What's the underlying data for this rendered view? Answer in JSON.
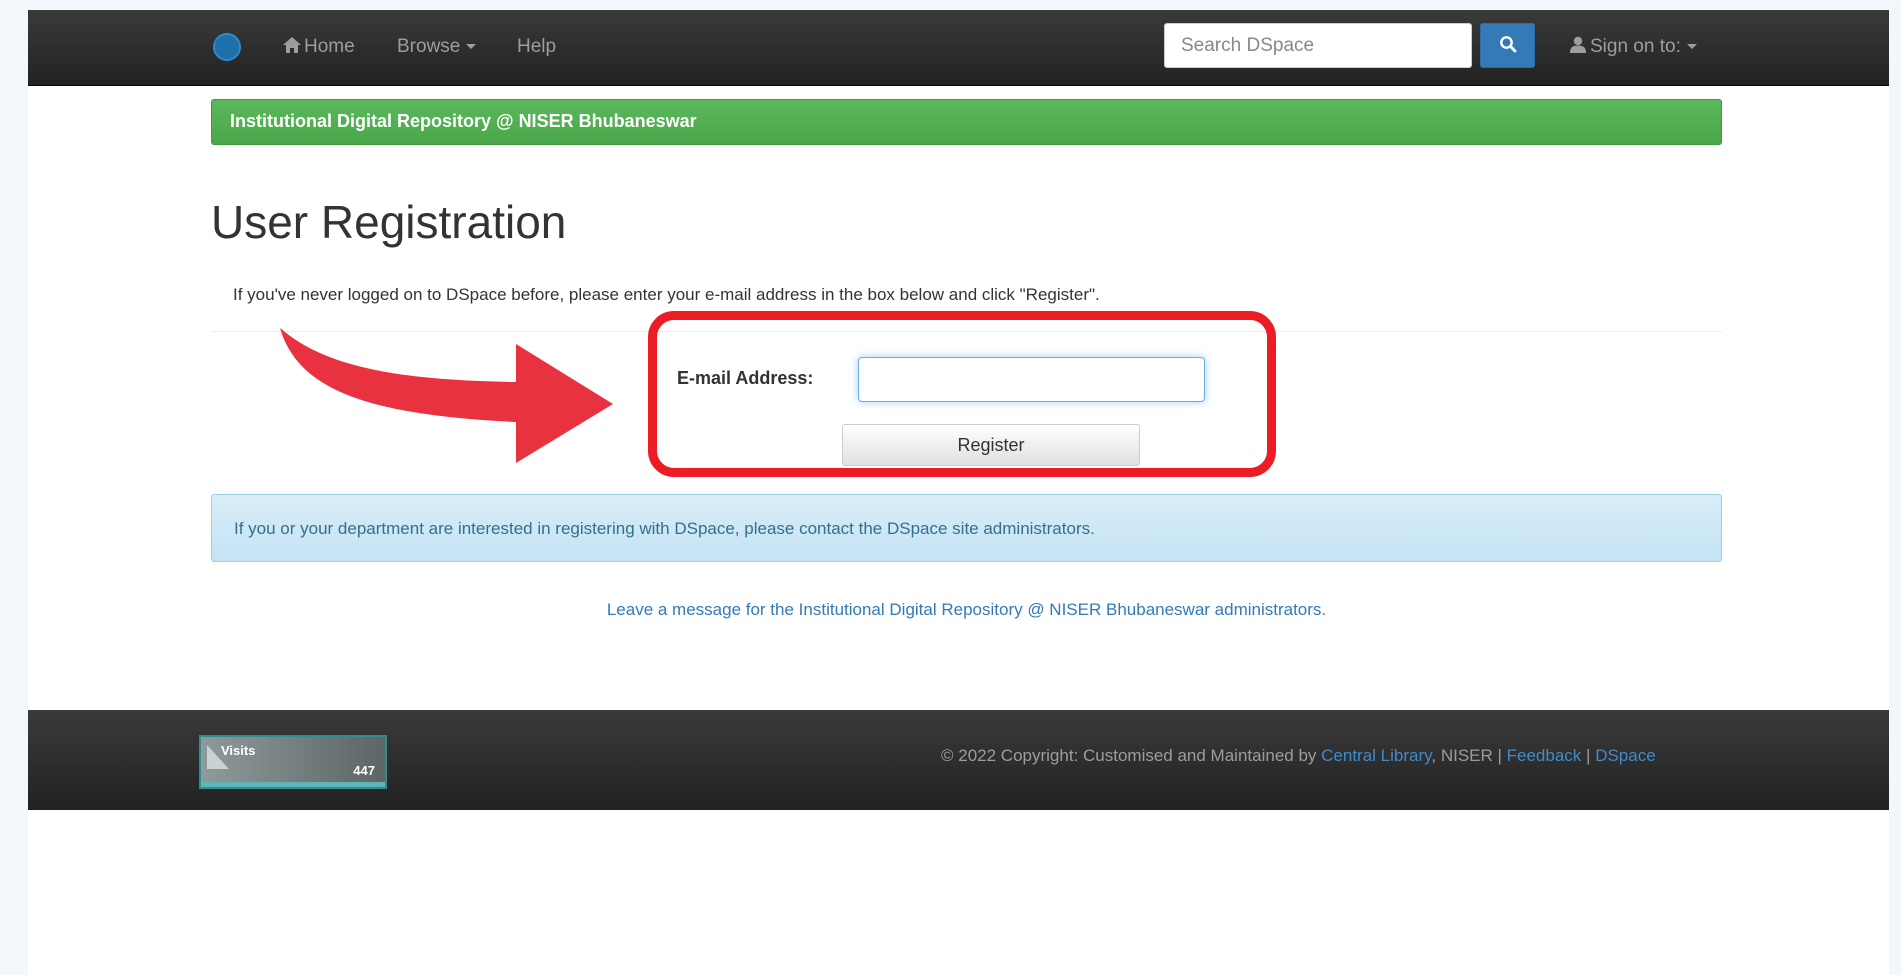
{
  "navbar": {
    "home_label": "Home",
    "browse_label": "Browse",
    "help_label": "Help",
    "search_placeholder": "Search DSpace",
    "sign_on_label": "Sign on to:"
  },
  "banner": {
    "text": "Institutional Digital Repository @ NISER Bhubaneswar"
  },
  "main": {
    "title": "User Registration",
    "intro": "If you've never logged on to DSpace before, please enter your e-mail address in the box below and click \"Register\".",
    "email_label": "E-mail Address:",
    "email_value": "",
    "register_label": "Register",
    "info_message": "If you or your department are interested in registering with DSpace, please contact the DSpace site administrators.",
    "admin_link": "Leave a message for the Institutional Digital Repository @ NISER Bhubaneswar administrators."
  },
  "footer": {
    "visits_label": "Visits",
    "visits_count": "447",
    "copyright_prefix": "© 2022 Copyright: Customised and Maintained by ",
    "central_library": "Central Library",
    "niser_text": ", NISER | ",
    "feedback_link": "Feedback",
    "separator": " | ",
    "dspace_link": "DSpace"
  },
  "annotation": {
    "highlight_color": "#ec1c24",
    "arrow_color": "#e83240"
  }
}
